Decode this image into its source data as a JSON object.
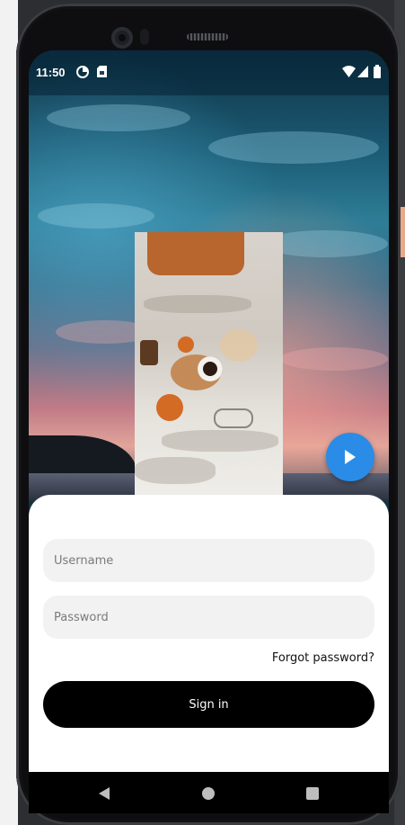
{
  "status_bar": {
    "time": "11:50",
    "icons": [
      "data-saver-icon",
      "sim-card-icon",
      "wifi-icon",
      "cell-signal-icon",
      "battery-icon"
    ]
  },
  "media": {
    "play_button_icon": "play-icon",
    "accent_color": "#2a8ce6"
  },
  "login": {
    "username_placeholder": "Username",
    "password_placeholder": "Password",
    "forgot_password": "Forgot password?",
    "sign_in": "Sign in",
    "button_color": "#000000",
    "field_color": "#f2f2f2"
  },
  "nav_bar": {
    "icons": [
      "back-icon",
      "home-icon",
      "recents-icon"
    ]
  }
}
